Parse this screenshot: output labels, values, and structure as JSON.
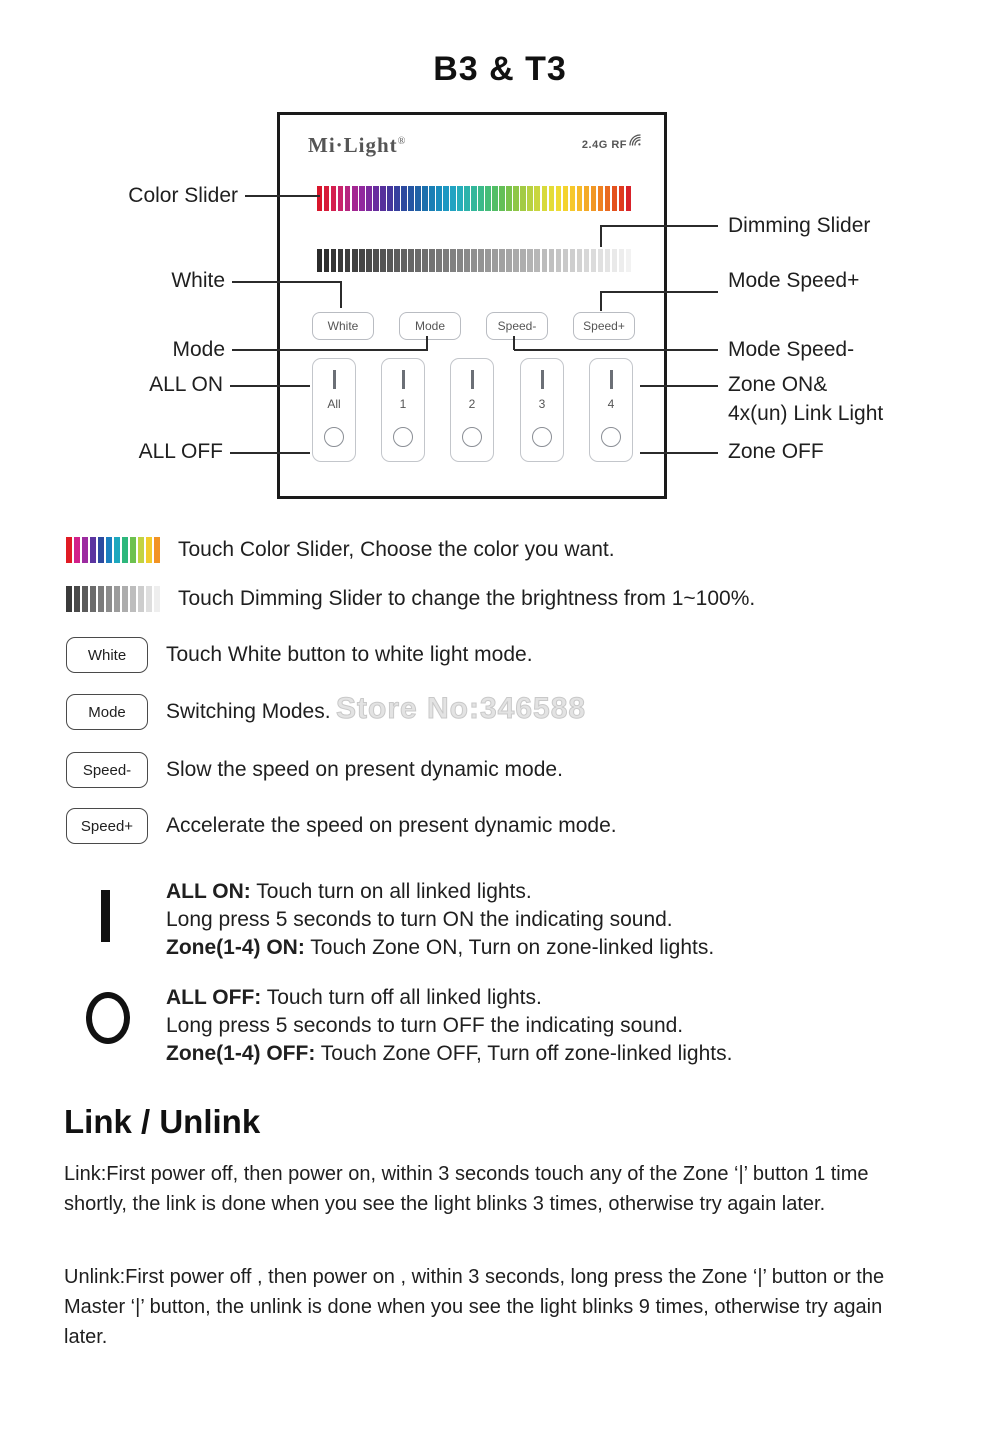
{
  "title": "B3 & T3",
  "device": {
    "brand": "Mi·Light",
    "brand_mark": "®",
    "rf_label": "2.4G RF",
    "rf_icon": "wifi-signal-icon",
    "buttons": [
      {
        "name": "white",
        "label": "White"
      },
      {
        "name": "mode",
        "label": "Mode"
      },
      {
        "name": "speed-minus",
        "label": "Speed-"
      },
      {
        "name": "speed-plus",
        "label": "Speed+"
      }
    ],
    "zones": [
      {
        "name": "all",
        "label": "All"
      },
      {
        "name": "1",
        "label": "1"
      },
      {
        "name": "2",
        "label": "2"
      },
      {
        "name": "3",
        "label": "3"
      },
      {
        "name": "4",
        "label": "4"
      }
    ],
    "color_slider_name": "color-slider",
    "dimming_slider_name": "dimming-slider"
  },
  "callouts": {
    "left": [
      {
        "key": "color-slider",
        "label": "Color Slider"
      },
      {
        "key": "white",
        "label": "White"
      },
      {
        "key": "mode",
        "label": "Mode"
      },
      {
        "key": "all-on",
        "label": "ALL ON"
      },
      {
        "key": "all-off",
        "label": "ALL OFF"
      }
    ],
    "right": [
      {
        "key": "dimming-slider",
        "label": "Dimming Slider"
      },
      {
        "key": "mode-speed-plus",
        "label": "Mode Speed+"
      },
      {
        "key": "mode-speed-minus",
        "label": "Mode Speed-"
      },
      {
        "key": "zone-on",
        "label": "Zone ON&"
      },
      {
        "key": "zone-on-2",
        "label": "4x(un) Link Light"
      },
      {
        "key": "zone-off",
        "label": "Zone OFF"
      }
    ]
  },
  "legend": [
    {
      "icon": "color-bar-icon",
      "text": "Touch Color Slider, Choose the color you want."
    },
    {
      "icon": "dimming-bar-icon",
      "text": "Touch Dimming Slider to change the brightness from 1~100%."
    },
    {
      "icon": "white-button-icon",
      "button": "White",
      "text": "Touch White button to white light mode."
    },
    {
      "icon": "mode-button-icon",
      "button": "Mode",
      "text": "Switching Modes."
    },
    {
      "icon": "speed-minus-button-icon",
      "button": "Speed-",
      "text": "Slow the speed on present dynamic mode."
    },
    {
      "icon": "speed-plus-button-icon",
      "button": "Speed+",
      "text": "Accelerate the speed on present dynamic mode."
    }
  ],
  "watermark": "Store No:346588",
  "on_block": {
    "glyph": "vertical-bar-icon",
    "line1_bold": "ALL ON:",
    "line1_rest": " Touch turn on all linked lights.",
    "line2": "Long press 5 seconds to turn ON the indicating sound.",
    "line3_bold": "Zone(1-4) ON:",
    "line3_rest": " Touch Zone ON, Turn on zone-linked lights."
  },
  "off_block": {
    "glyph": "circle-icon",
    "line1_bold": "ALL OFF:",
    "line1_rest": " Touch turn off all linked lights.",
    "line2": "Long press 5 seconds to turn OFF the indicating sound.",
    "line3_bold": "Zone(1-4) OFF:",
    "line3_rest": " Touch Zone OFF, Turn off zone-linked lights."
  },
  "link_section": {
    "heading": "Link / Unlink",
    "link_label": "Link:",
    "link_text": "First power off, then power on, within 3 seconds touch any of the Zone ‘|’ button 1 time shortly, the link is done when you see the light blinks 3 times, otherwise try again later.",
    "unlink_label": "Unlink:",
    "unlink_text": "First power off , then power on , within 3 seconds, long press the Zone ‘|’ button or the Master ‘|’ button, the unlink is done when you see the light blinks 9 times, otherwise try again later."
  },
  "chart_data": {
    "type": "heatmap",
    "title": "Color Slider spectrum strip",
    "device_color_slider": [
      "#d8162b",
      "#d71c3a",
      "#d42050",
      "#c8236b",
      "#b62580",
      "#a32792",
      "#91289e",
      "#7c2a9e",
      "#682c9e",
      "#56309c",
      "#45369c",
      "#363f9e",
      "#2c4a9f",
      "#2555a2",
      "#2062a6",
      "#1c70ad",
      "#197fb5",
      "#1a8cbd",
      "#1d98c2",
      "#22a3c2",
      "#27adba",
      "#2db3ab",
      "#33b79b",
      "#3bba8a",
      "#45bd78",
      "#53be66",
      "#64bf57",
      "#79c24c",
      "#8ec647",
      "#a3cb44",
      "#b7d142",
      "#c9d63f",
      "#d8da3c",
      "#e3dc38",
      "#eedb34",
      "#f4d32f",
      "#f6c82c",
      "#f6ba2a",
      "#f4aa27",
      "#f19725",
      "#ee8122",
      "#e96a20",
      "#e4521e",
      "#df3a1f",
      "#d8222a"
    ],
    "device_dimming_slider_from": "#2b2b2b",
    "device_dimming_slider_to": "#f2f2f2",
    "legend_color_bar": [
      "#e01b24",
      "#d2218a",
      "#9c2ba0",
      "#5b34a0",
      "#2c4aa0",
      "#1b7fc0",
      "#1da8be",
      "#2eb77c",
      "#6dc14f",
      "#c3d341",
      "#f2cc2c",
      "#f29323"
    ],
    "legend_dim_bar_from": "#3a3a3a",
    "legend_dim_bar_to": "#eeeeee"
  }
}
